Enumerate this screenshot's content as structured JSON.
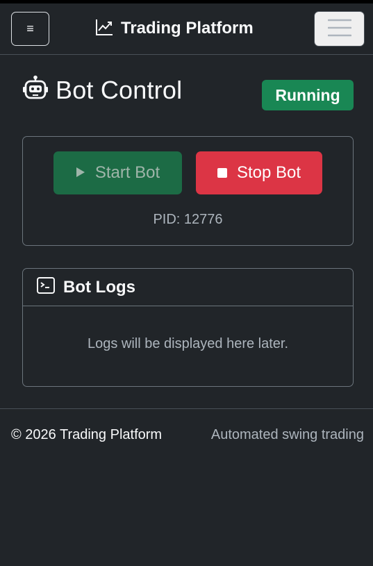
{
  "navbar": {
    "sidebar_toggle_glyph": "≡",
    "brand_title": "Trading Platform"
  },
  "page": {
    "title": "Bot Control",
    "status": "Running"
  },
  "controls": {
    "start_label": "Start Bot",
    "stop_label": "Stop Bot",
    "pid_text": "PID: 12776"
  },
  "logs": {
    "title": "Bot Logs",
    "placeholder": "Logs will be displayed here later."
  },
  "footer": {
    "copyright": "© 2026 Trading Platform",
    "tagline": "Automated swing trading"
  },
  "colors": {
    "background": "#212529",
    "success": "#198754",
    "danger": "#dc3545",
    "muted": "#adb5bd"
  },
  "icons": {
    "brand": "graph-up-icon",
    "title": "robot-icon",
    "start": "play-icon",
    "stop": "stop-icon",
    "logs": "terminal-icon",
    "nav_toggler": "hamburger-icon"
  }
}
